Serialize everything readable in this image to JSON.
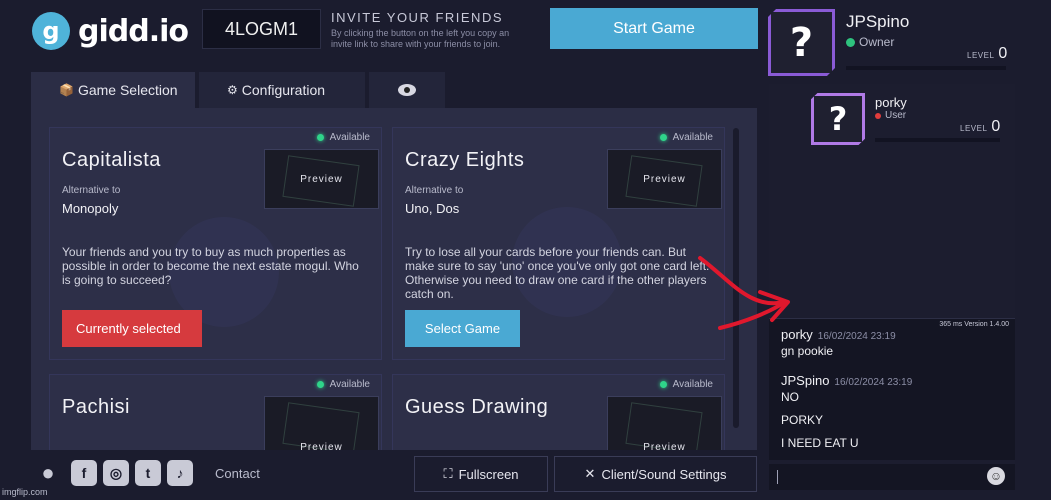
{
  "header": {
    "logo_glyph": "g",
    "logo_text": "gidd.io",
    "room_code": "4LOGM1",
    "invite_title": "INVITE YOUR FRIENDS",
    "invite_sub": "By clicking the button on the left you copy an invite link to share with your friends to join.",
    "start_label": "Start Game"
  },
  "tabs": [
    {
      "icon": "📦",
      "label": "Game Selection"
    },
    {
      "icon": "⚙",
      "label": "Configuration"
    },
    {
      "icon": "eye-icon",
      "label": ""
    }
  ],
  "games": [
    {
      "title": "Capitalista",
      "alt_label": "Alternative to",
      "alt_value": "Monopoly",
      "status": "Available",
      "preview": "Preview",
      "description": "Your friends and you try to buy as much properties as possible in order to become the next estate mogul. Who is going to succeed?",
      "button": "Currently selected"
    },
    {
      "title": "Crazy Eights",
      "alt_label": "Alternative to",
      "alt_value": "Uno, Dos",
      "status": "Available",
      "preview": "Preview",
      "description": "Try to lose all your cards before your friends can. But make sure to say 'uno' once you've only got one card left. Otherwise you need to draw one card if the other players catch on.",
      "button": "Select Game"
    },
    {
      "title": "Pachisi",
      "status": "Available",
      "preview": "Preview"
    },
    {
      "title": "Guess Drawing",
      "status": "Available",
      "preview": "Preview"
    }
  ],
  "players": [
    {
      "name": "JPSpino",
      "role": "Owner",
      "level_label": "LEVEL",
      "level": "0",
      "role_color": "#2ec27e"
    },
    {
      "name": "porky",
      "role": "User",
      "level_label": "LEVEL",
      "level": "0",
      "role_color": "#e03c3c"
    }
  ],
  "chat": {
    "meta": "365 ms Version 1.4.00",
    "messages": [
      {
        "author": "porky",
        "time": "16/02/2024 23:19",
        "lines": [
          "gn pookie"
        ]
      },
      {
        "author": "JPSpino",
        "time": "16/02/2024 23:19",
        "lines": [
          "NO",
          "PORKY",
          "I NEED EAT U"
        ]
      }
    ]
  },
  "footer": {
    "contact": "Contact",
    "fullscreen": "Fullscreen",
    "settings": "Client/Sound Settings"
  },
  "watermark": "imgflip.com",
  "colors": {
    "background": "#1b1c2e",
    "panel": "#2b2d45",
    "accent_blue": "#4aa9d3",
    "accent_red": "#d63a3e",
    "available_green": "#2fd48a",
    "avatar_purple": "#8a5bd6",
    "annotation_arrow": "#e0182d"
  }
}
